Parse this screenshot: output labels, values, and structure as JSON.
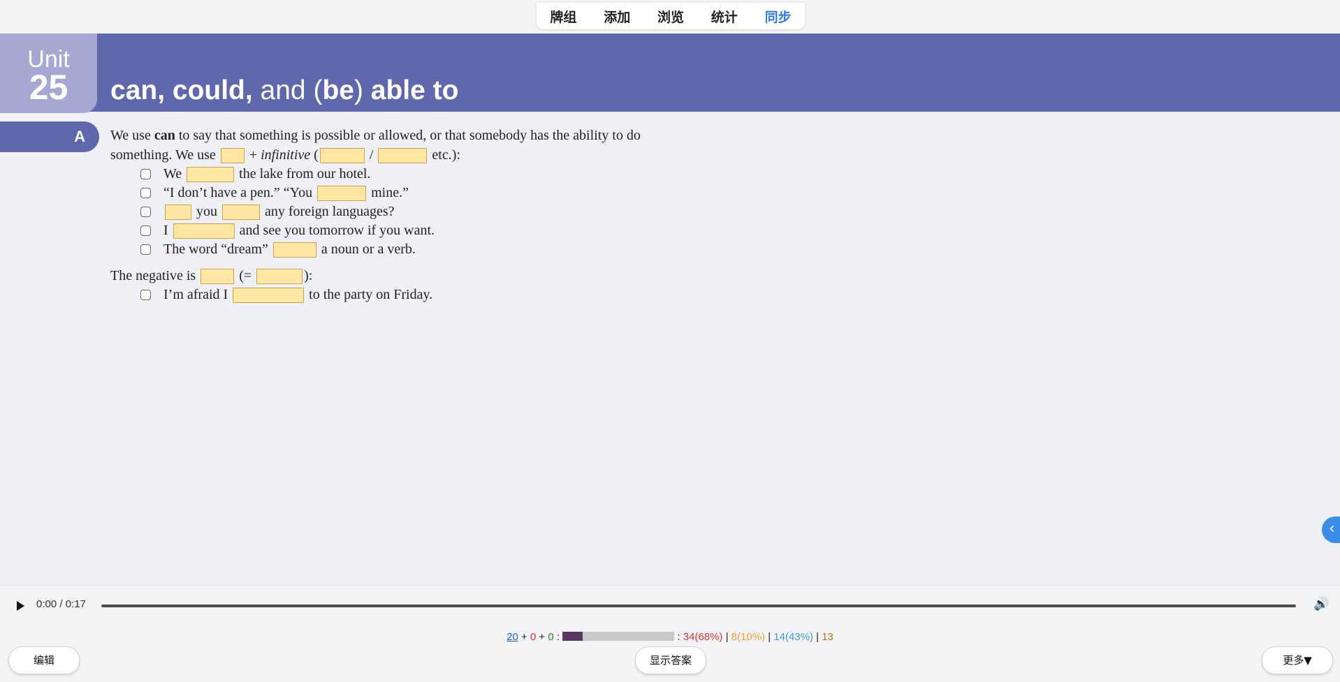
{
  "nav": {
    "items": [
      {
        "label": "牌组",
        "active": false
      },
      {
        "label": "添加",
        "active": false
      },
      {
        "label": "浏览",
        "active": false
      },
      {
        "label": "统计",
        "active": false
      },
      {
        "label": "同步",
        "active": true
      }
    ],
    "active_color": "#2a7de1"
  },
  "unit": {
    "word": "Unit",
    "number": "25"
  },
  "title": {
    "p1": "can, could,",
    "p2": " and (",
    "p3": "be",
    "p4": ") ",
    "p5": "able to"
  },
  "section": {
    "letter": "A"
  },
  "intro": {
    "l1a": "We use ",
    "l1b": "can",
    "l1c": " to say that something is possible or allowed, or that somebody has the ability to do",
    "l2a": "something.  We use ",
    "l2b": " + ",
    "l2c": "infinitive",
    "l2d": " (",
    "l2e": " / ",
    "l2f": " etc.):"
  },
  "examples": {
    "e1a": "We ",
    "e1b": " the lake from our hotel.",
    "e2a": "“I don’t have a pen.”    “You ",
    "e2b": " mine.”",
    "e3a": " you ",
    "e3b": " any foreign languages?",
    "e4a": "I ",
    "e4b": " and see you tomorrow if you want.",
    "e5a": "The word “dream” ",
    "e5b": " a noun or a verb."
  },
  "negative": {
    "a": "The negative is ",
    "b": " (= ",
    "c": "):",
    "ex_a": "I’m afraid I ",
    "ex_b": " to the party on Friday."
  },
  "side_toggle": {
    "icon": "chevron-left-icon",
    "glyph": "‹"
  },
  "audio": {
    "time": "0:00 / 0:17",
    "progress": 0
  },
  "stats": {
    "new": "20",
    "plus1": " + ",
    "learn": "0",
    "plus2": " + ",
    "review": "0",
    "colon": " : ",
    "after": " : ",
    "s1": "34(68%)",
    "sep1": " | ",
    "s2": "8(10%)",
    "sep2": " | ",
    "s3": "14(43%)",
    "sep3": " | ",
    "s4": "13",
    "bar_fill": 0.18
  },
  "buttons": {
    "edit": "编辑",
    "show_answer": "显示答案",
    "more": "更多▼"
  },
  "colors": {
    "header_band": "#5f68ac",
    "unit_box": "#a4a8d2",
    "gap_fill": "#ffe7a3"
  }
}
